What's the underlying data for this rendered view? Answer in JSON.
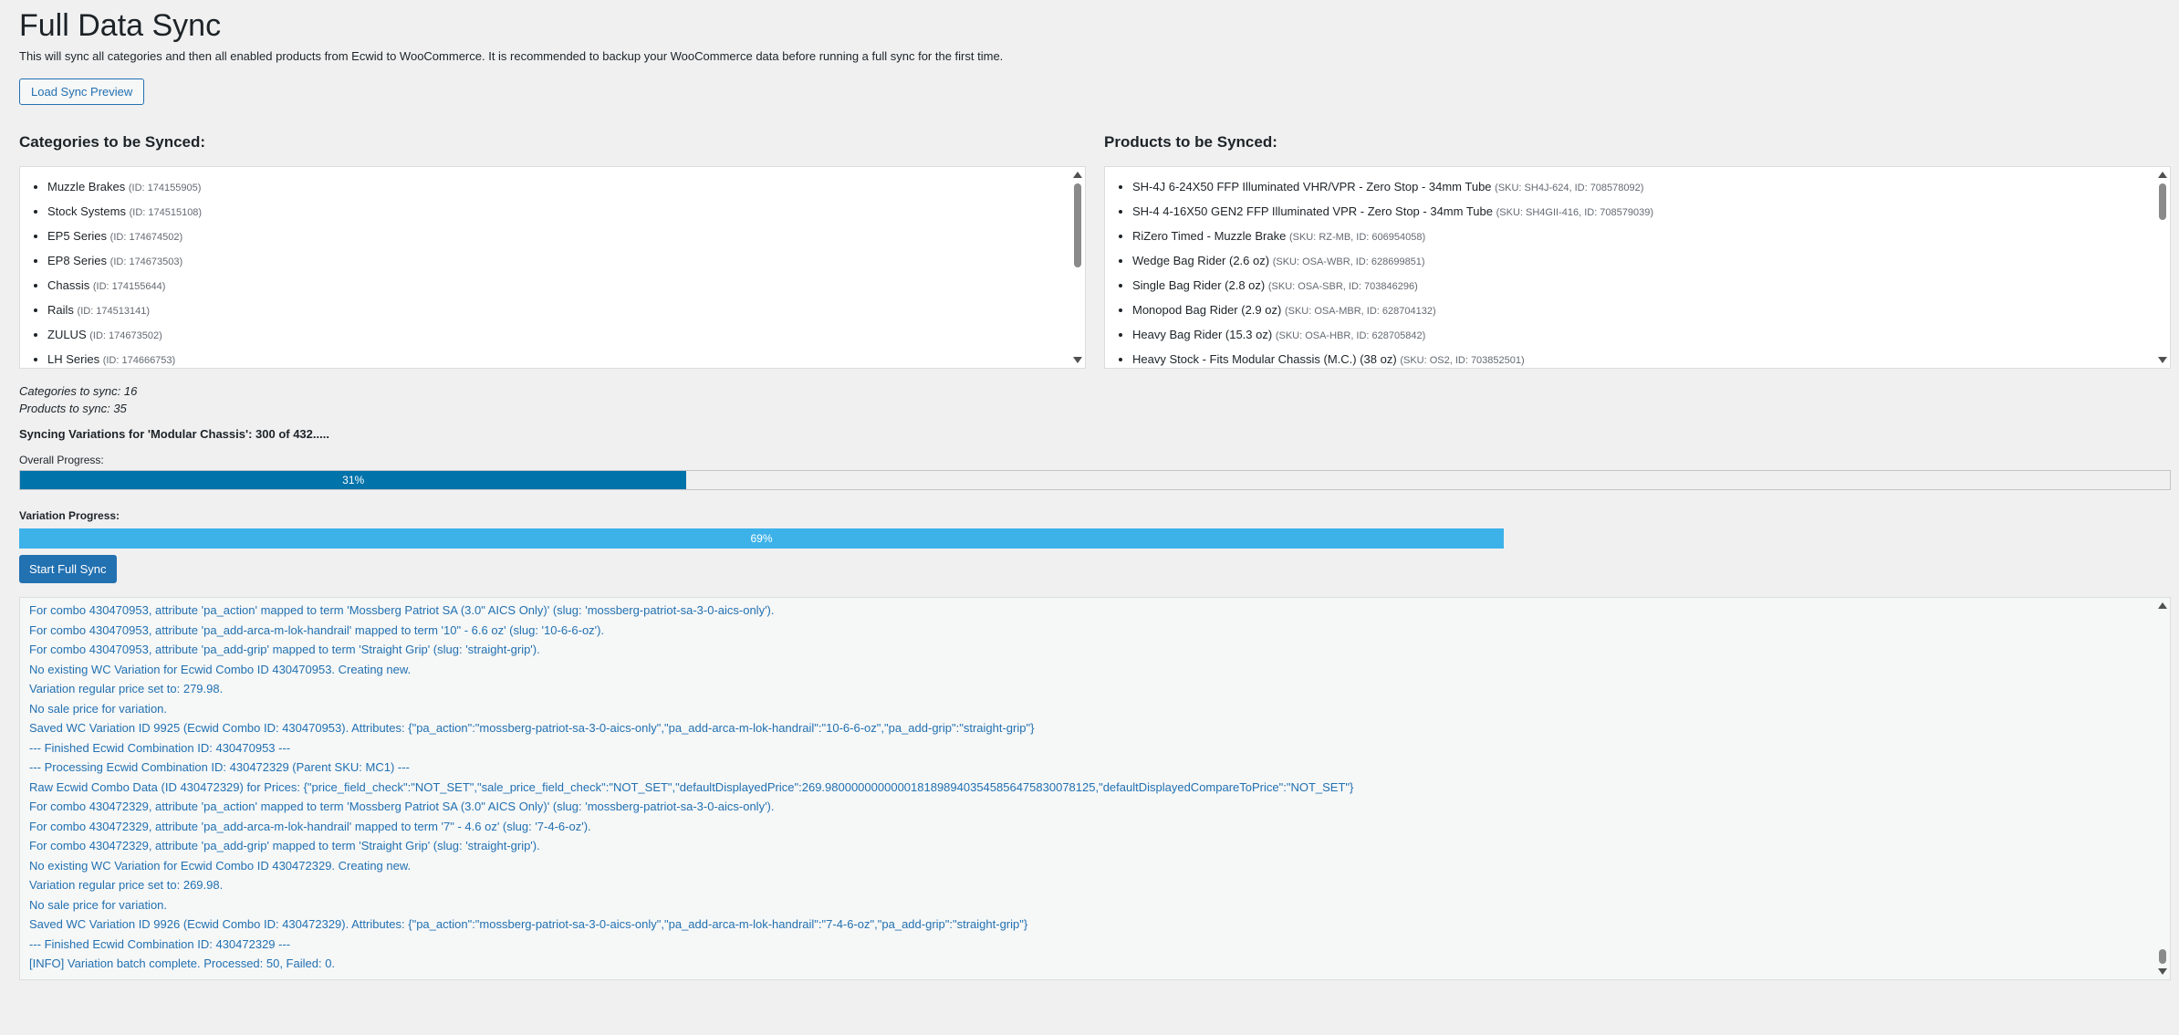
{
  "page": {
    "title": "Full Data Sync",
    "description": "This will sync all categories and then all enabled products from Ecwid to WooCommerce. It is recommended to backup your WooCommerce data before running a full sync for the first time.",
    "load_preview_label": "Load Sync Preview"
  },
  "categories": {
    "title": "Categories to be Synced:",
    "items": [
      {
        "name": "Muzzle Brakes",
        "meta": "(ID: 174155905)"
      },
      {
        "name": "Stock Systems",
        "meta": "(ID: 174515108)"
      },
      {
        "name": "EP5 Series",
        "meta": "(ID: 174674502)"
      },
      {
        "name": "EP8 Series",
        "meta": "(ID: 174673503)"
      },
      {
        "name": "Chassis",
        "meta": "(ID: 174155644)"
      },
      {
        "name": "Rails",
        "meta": "(ID: 174513141)"
      },
      {
        "name": "ZULUS",
        "meta": "(ID: 174673502)"
      },
      {
        "name": "LH Series",
        "meta": "(ID: 174666753)"
      }
    ]
  },
  "products": {
    "title": "Products to be Synced:",
    "items": [
      {
        "name": "SH-4J 6-24X50 FFP Illuminated VHR/VPR - Zero Stop - 34mm Tube",
        "meta": "(SKU: SH4J-624, ID: 708578092)"
      },
      {
        "name": "SH-4 4-16X50 GEN2 FFP Illuminated VPR - Zero Stop - 34mm Tube",
        "meta": "(SKU: SH4GII-416, ID: 708579039)"
      },
      {
        "name": "RiZero Timed - Muzzle Brake",
        "meta": "(SKU: RZ-MB, ID: 606954058)"
      },
      {
        "name": "Wedge Bag Rider (2.6 oz)",
        "meta": "(SKU: OSA-WBR, ID: 628699851)"
      },
      {
        "name": "Single Bag Rider (2.8 oz)",
        "meta": "(SKU: OSA-SBR, ID: 703846296)"
      },
      {
        "name": "Monopod Bag Rider (2.9 oz)",
        "meta": "(SKU: OSA-MBR, ID: 628704132)"
      },
      {
        "name": "Heavy Bag Rider (15.3 oz)",
        "meta": "(SKU: OSA-HBR, ID: 628705842)"
      },
      {
        "name": "Heavy Stock - Fits Modular Chassis (M.C.) (38 oz)",
        "meta": "(SKU: OS2, ID: 703852501)"
      }
    ]
  },
  "stats": {
    "categories": "Categories to sync: 16",
    "products": "Products to sync: 35"
  },
  "status": {
    "syncing_text": "Syncing Variations for 'Modular Chassis': 300 of 432....."
  },
  "overall_progress": {
    "label": "Overall Progress:",
    "value": 31,
    "text": "31%",
    "color": "#0073aa"
  },
  "variation_progress": {
    "label": "Variation Progress:",
    "value": 69,
    "text": "69%",
    "color": "#3db2e9"
  },
  "start_button_label": "Start Full Sync",
  "log": [
    "For combo 430470953, attribute 'pa_action' mapped to term 'Mossberg Patriot SA (3.0\" AICS Only)' (slug: 'mossberg-patriot-sa-3-0-aics-only').",
    "For combo 430470953, attribute 'pa_add-arca-m-lok-handrail' mapped to term '10\" - 6.6 oz' (slug: '10-6-6-oz').",
    "For combo 430470953, attribute 'pa_add-grip' mapped to term 'Straight Grip' (slug: 'straight-grip').",
    "No existing WC Variation for Ecwid Combo ID 430470953. Creating new.",
    "Variation regular price set to: 279.98.",
    "No sale price for variation.",
    "Saved WC Variation ID 9925 (Ecwid Combo ID: 430470953). Attributes: {\"pa_action\":\"mossberg-patriot-sa-3-0-aics-only\",\"pa_add-arca-m-lok-handrail\":\"10-6-6-oz\",\"pa_add-grip\":\"straight-grip\"}",
    "--- Finished Ecwid Combination ID: 430470953 ---",
    "--- Processing Ecwid Combination ID: 430472329 (Parent SKU: MC1) ---",
    "Raw Ecwid Combo Data (ID 430472329) for Prices: {\"price_field_check\":\"NOT_SET\",\"sale_price_field_check\":\"NOT_SET\",\"defaultDisplayedPrice\":269.98000000000001818989403545856475830078125,\"defaultDisplayedCompareToPrice\":\"NOT_SET\"}",
    "For combo 430472329, attribute 'pa_action' mapped to term 'Mossberg Patriot SA (3.0\" AICS Only)' (slug: 'mossberg-patriot-sa-3-0-aics-only').",
    "For combo 430472329, attribute 'pa_add-arca-m-lok-handrail' mapped to term '7\" - 4.6 oz' (slug: '7-4-6-oz').",
    "For combo 430472329, attribute 'pa_add-grip' mapped to term 'Straight Grip' (slug: 'straight-grip').",
    "No existing WC Variation for Ecwid Combo ID 430472329. Creating new.",
    "Variation regular price set to: 269.98.",
    "No sale price for variation.",
    "Saved WC Variation ID 9926 (Ecwid Combo ID: 430472329). Attributes: {\"pa_action\":\"mossberg-patriot-sa-3-0-aics-only\",\"pa_add-arca-m-lok-handrail\":\"7-4-6-oz\",\"pa_add-grip\":\"straight-grip\"}",
    "--- Finished Ecwid Combination ID: 430472329 ---",
    "[INFO] Variation batch complete. Processed: 50, Failed: 0."
  ]
}
